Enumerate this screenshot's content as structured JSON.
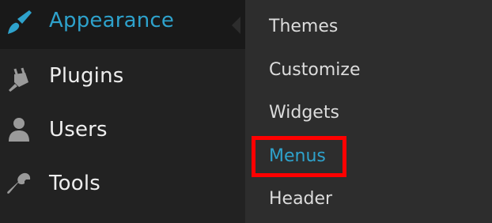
{
  "sidebar": {
    "items": [
      {
        "label": "Appearance",
        "icon": "paintbrush-icon",
        "current": true
      },
      {
        "label": "Plugins",
        "icon": "plugin-icon",
        "current": false
      },
      {
        "label": "Users",
        "icon": "user-icon",
        "current": false
      },
      {
        "label": "Tools",
        "icon": "wrench-icon",
        "current": false
      }
    ]
  },
  "submenu": {
    "items": [
      {
        "label": "Themes"
      },
      {
        "label": "Customize"
      },
      {
        "label": "Widgets"
      },
      {
        "label": "Menus",
        "active": true
      },
      {
        "label": "Header"
      }
    ]
  },
  "colors": {
    "sidebar_bg": "#222222",
    "submenu_bg": "#2d2d2d",
    "accent": "#2ea2cc",
    "highlight": "#ff0000"
  }
}
